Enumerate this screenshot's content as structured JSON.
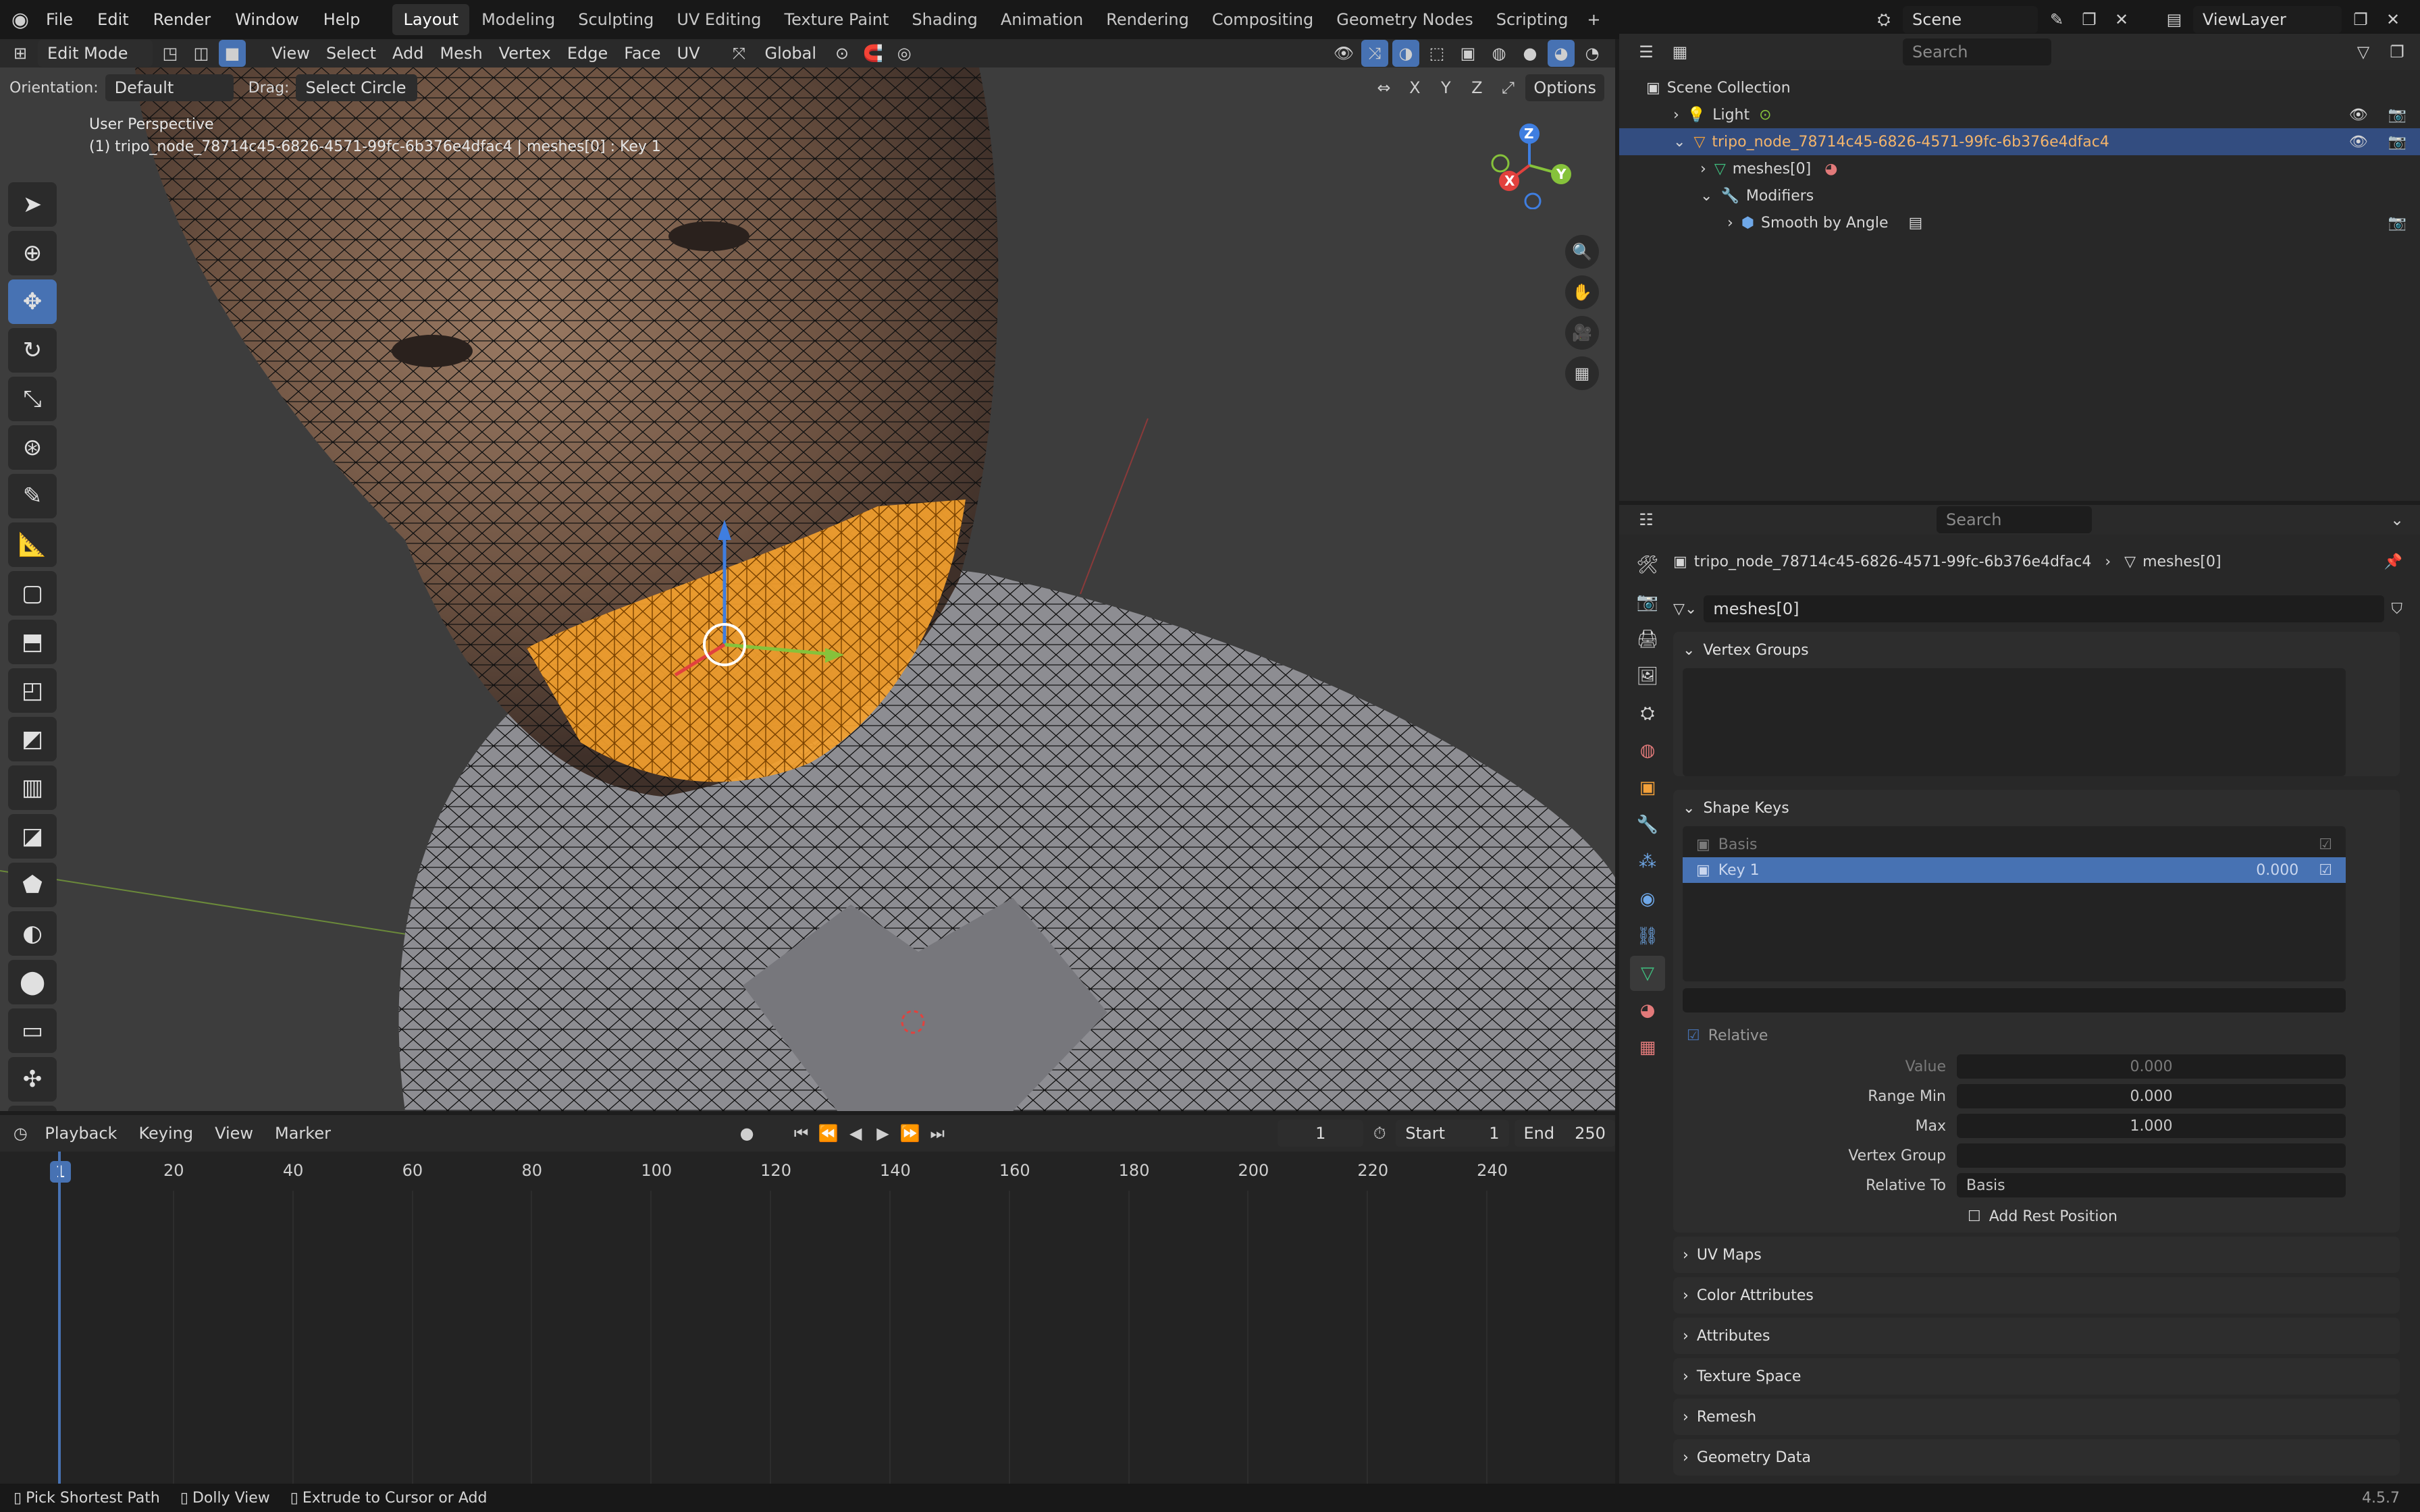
{
  "app": {
    "logo_icon": "blender-logo-icon",
    "version": "4.5.7"
  },
  "menu": [
    "File",
    "Edit",
    "Render",
    "Window",
    "Help"
  ],
  "workspaces": [
    "Layout",
    "Modeling",
    "Sculpting",
    "UV Editing",
    "Texture Paint",
    "Shading",
    "Animation",
    "Rendering",
    "Compositing",
    "Geometry Nodes",
    "Scripting"
  ],
  "active_workspace": "Layout",
  "scene": {
    "name": "Scene",
    "view_layer": "ViewLayer"
  },
  "viewport": {
    "mode": "Edit Mode",
    "menus": [
      "View",
      "Select",
      "Add",
      "Mesh",
      "Vertex",
      "Edge",
      "Face",
      "UV"
    ],
    "transform": "Global",
    "orientation_label": "Orientation:",
    "orientation": "Default",
    "drag_label": "Drag:",
    "drag": "Select Circle",
    "axes": [
      "X",
      "Y",
      "Z"
    ],
    "options": "Options",
    "info_line1": "User Perspective",
    "info_line2": "(1) tripo_node_78714c45-6826-4571-99fc-6b376e4dfac4 | meshes[0] : Key 1",
    "gizmo_axes": {
      "x": "X",
      "y": "Y",
      "z": "Z"
    },
    "colors": {
      "selection": "#ff9f2e",
      "x_axis": "#e2413d",
      "y_axis": "#86c23b",
      "z_axis": "#3f7ee0"
    }
  },
  "outliner": {
    "search_placeholder": "Search",
    "root": "Scene Collection",
    "items": [
      {
        "name": "Light",
        "depth": 1
      },
      {
        "name": "tripo_node_78714c45-6826-4571-99fc-6b376e4dfac4",
        "depth": 1,
        "selected": true
      },
      {
        "name": "meshes[0]",
        "depth": 2
      },
      {
        "name": "Modifiers",
        "depth": 2
      },
      {
        "name": "Smooth by Angle",
        "depth": 3
      }
    ]
  },
  "properties": {
    "search_placeholder": "Search",
    "breadcrumb": [
      "tripo_node_78714c45-6826-4571-99fc-6b376e4dfac4",
      "meshes[0]"
    ],
    "mesh_name": "meshes[0]",
    "vertex_groups": "Vertex Groups",
    "shape_keys": "Shape Keys",
    "keys": [
      {
        "name": "Basis",
        "value": ""
      },
      {
        "name": "Key 1",
        "value": "0.000"
      }
    ],
    "relative": "Relative",
    "value_label": "Value",
    "value": "0.000",
    "range_min_label": "Range Min",
    "range_min": "0.000",
    "max_label": "Max",
    "max": "1.000",
    "vertex_group_label": "Vertex Group",
    "vertex_group": "",
    "relative_to_label": "Relative To",
    "relative_to": "Basis",
    "add_rest": "Add Rest Position",
    "sections": [
      "UV Maps",
      "Color Attributes",
      "Attributes",
      "Texture Space",
      "Remesh",
      "Geometry Data"
    ]
  },
  "timeline": {
    "menus": [
      "Playback",
      "Keying",
      "View",
      "Marker"
    ],
    "current_frame": "1",
    "start_label": "Start",
    "start": "1",
    "end_label": "End",
    "end": "250",
    "ticks": [
      "1",
      "20",
      "40",
      "60",
      "80",
      "100",
      "120",
      "140",
      "160",
      "180",
      "200",
      "220",
      "240"
    ]
  },
  "status": [
    "Pick Shortest Path",
    "Dolly View",
    "Extrude to Cursor or Add"
  ]
}
